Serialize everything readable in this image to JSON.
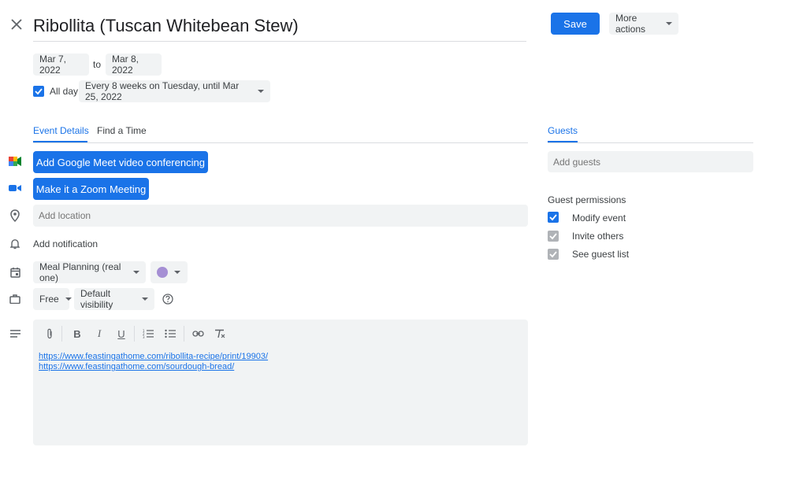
{
  "header": {
    "title": "Ribollita (Tuscan Whitebean Stew)",
    "save_label": "Save",
    "more_actions_label": "More actions"
  },
  "dates": {
    "start": "Mar 7, 2022",
    "to_label": "to",
    "end": "Mar 8, 2022",
    "all_day_label": "All day",
    "recurrence": "Every 8 weeks on Tuesday, until Mar 25, 2022"
  },
  "tabs": {
    "event_details": "Event Details",
    "find_a_time": "Find a Time",
    "guests": "Guests"
  },
  "details": {
    "meet_button": "Add Google Meet video conferencing",
    "zoom_button": "Make it a Zoom Meeting",
    "location_placeholder": "Add location",
    "notification_label": "Add notification",
    "calendar_name": "Meal Planning (real one)",
    "event_color": "#a58fd4",
    "availability": "Free",
    "visibility": "Default visibility"
  },
  "description": {
    "links": [
      "https://www.feastingathome.com/ribollita-recipe/print/19903/",
      "https://www.feastingathome.com/sourdough-bread/"
    ]
  },
  "guests": {
    "add_placeholder": "Add guests",
    "permissions_label": "Guest permissions",
    "permissions": [
      {
        "label": "Modify event",
        "checked": true,
        "enabled": true
      },
      {
        "label": "Invite others",
        "checked": true,
        "enabled": false
      },
      {
        "label": "See guest list",
        "checked": true,
        "enabled": false
      }
    ]
  },
  "colors": {
    "accent": "#1a73e8",
    "field_bg": "#f1f3f4"
  }
}
